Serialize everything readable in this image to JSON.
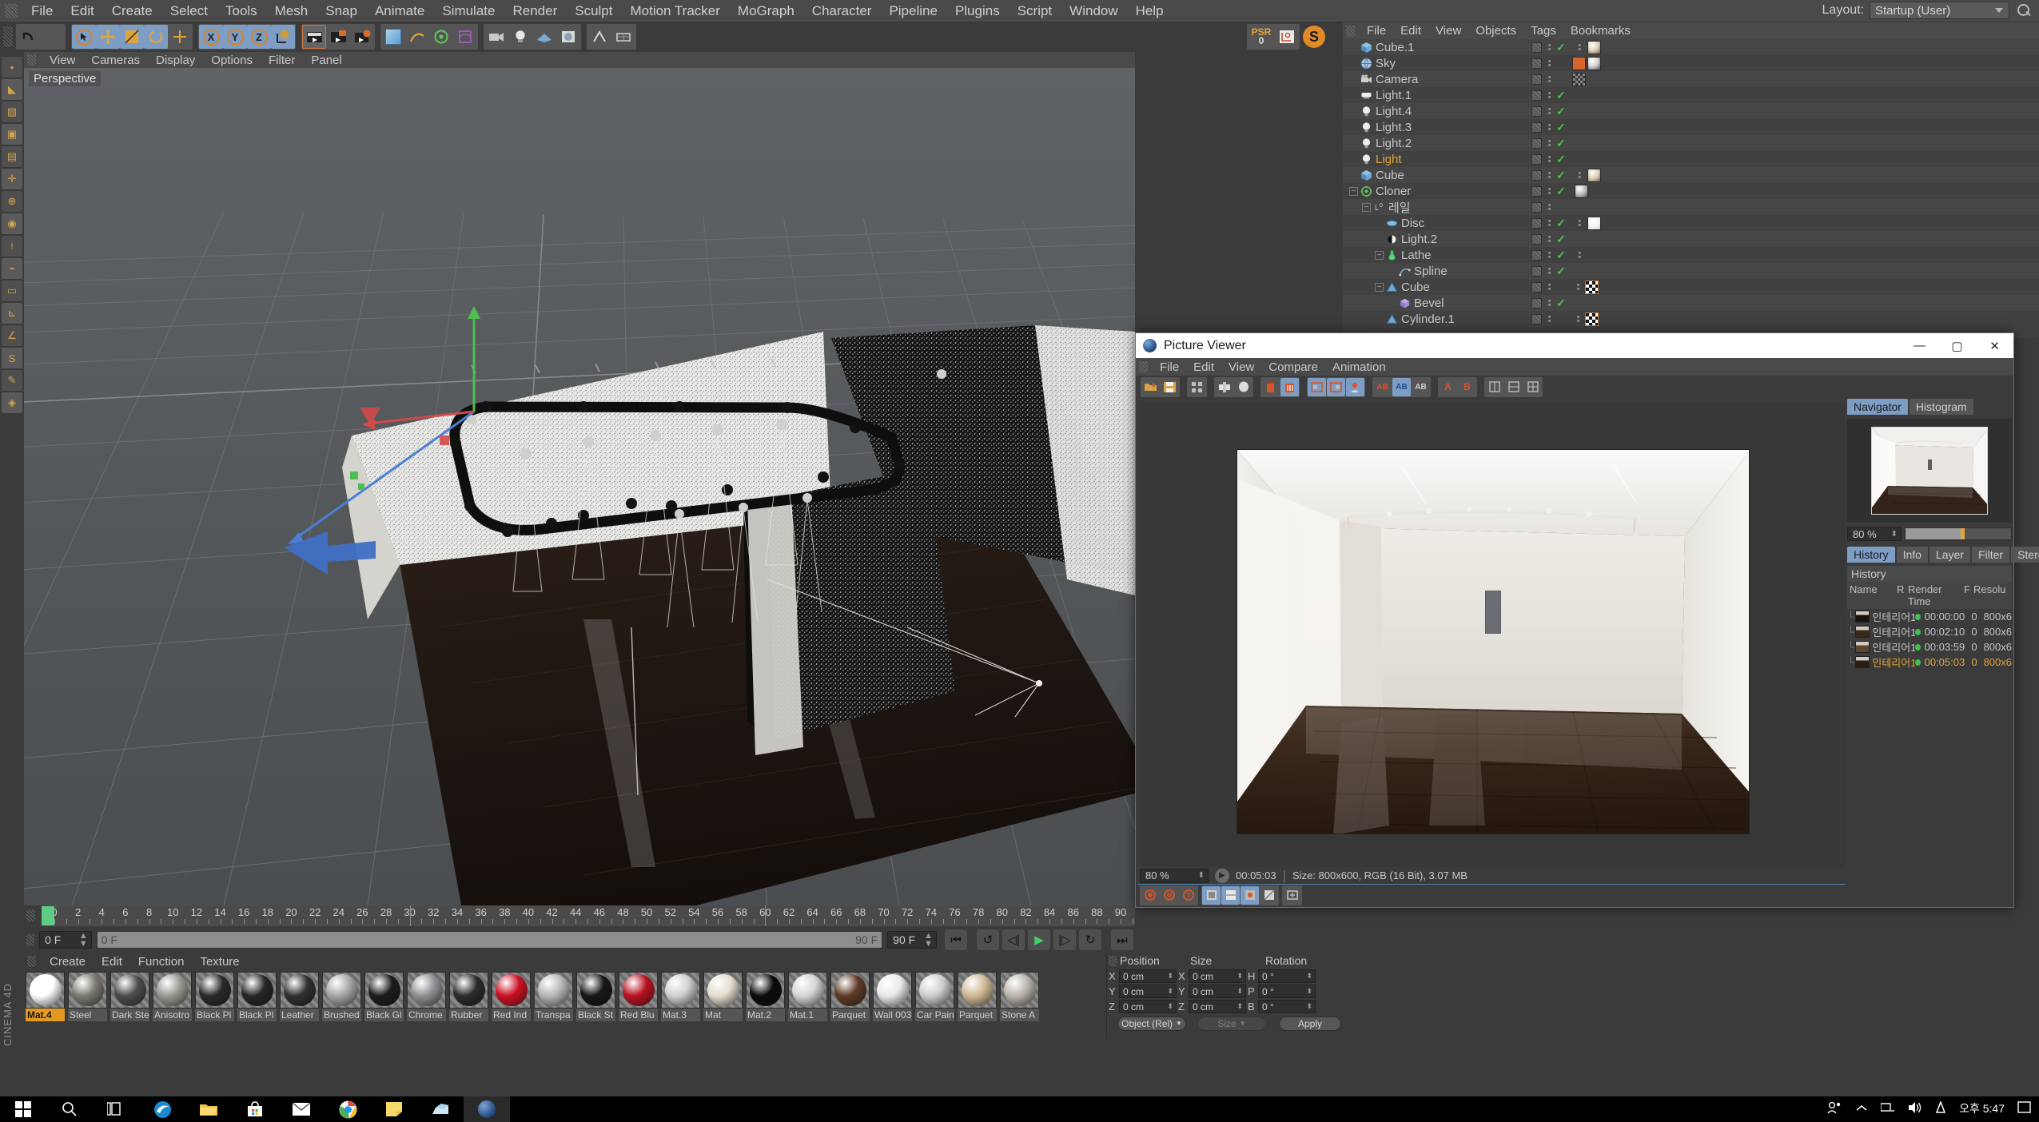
{
  "app": {
    "title": "CINEMA 4D",
    "sidebar_label": "CINEMA 4D"
  },
  "menubar": {
    "items": [
      "File",
      "Edit",
      "Create",
      "Select",
      "Tools",
      "Mesh",
      "Snap",
      "Animate",
      "Simulate",
      "Render",
      "Sculpt",
      "Motion Tracker",
      "MoGraph",
      "Character",
      "Pipeline",
      "Plugins",
      "Script",
      "Window",
      "Help"
    ],
    "layout_label": "Layout:",
    "layout_value": "Startup (User)"
  },
  "toolbar": {
    "psr_label": "PSR",
    "psr_value": "0",
    "buttons": [
      "undo",
      "redo",
      "select-live",
      "move",
      "scale",
      "rotate",
      "axis",
      "x-axis",
      "y-axis",
      "z-axis",
      "world-axis",
      "render-view",
      "render-region",
      "render-settings",
      "cube-primitive",
      "spline-pen",
      "array",
      "deformer",
      "camera",
      "light",
      "floor",
      "material",
      "texture-axis",
      "workplane"
    ]
  },
  "viewport": {
    "menus": [
      "View",
      "Cameras",
      "Display",
      "Options",
      "Filter",
      "Panel"
    ],
    "label": "Perspective"
  },
  "timeline": {
    "ticks": [
      0,
      2,
      4,
      6,
      8,
      10,
      12,
      14,
      16,
      18,
      20,
      22,
      24,
      26,
      28,
      30,
      32,
      34,
      36,
      38,
      40,
      42,
      44,
      46,
      48,
      50,
      52,
      54,
      56,
      58,
      60,
      62,
      64,
      66,
      68,
      70,
      72,
      74,
      76,
      78,
      80,
      82,
      84,
      86,
      88,
      90
    ],
    "current_frame": "0 F",
    "scrub_start": "0 F",
    "scrub_end": "90 F",
    "end_frame": "90 F",
    "transport": [
      "go-to-start",
      "play-backward",
      "step-back",
      "play-forward",
      "step-forward",
      "loop",
      "go-to-end"
    ]
  },
  "materials": {
    "menus": [
      "Create",
      "Edit",
      "Function",
      "Texture"
    ],
    "items": [
      {
        "name": "Mat.4",
        "color": "#ffffff",
        "selected": true
      },
      {
        "name": "Steel",
        "color": "#7d7a72",
        "selected": false
      },
      {
        "name": "Dark Ste",
        "color": "#4e4d4a",
        "selected": false
      },
      {
        "name": "Anisotro",
        "color": "#9b9892",
        "selected": false
      },
      {
        "name": "Black Pl",
        "color": "#2a2a2a",
        "selected": false
      },
      {
        "name": "Black Pl",
        "color": "#262626",
        "selected": false
      },
      {
        "name": "Leather",
        "color": "#303030",
        "selected": false
      },
      {
        "name": "Brushed",
        "color": "#a6a6a2",
        "selected": false
      },
      {
        "name": "Black Gl",
        "color": "#1c1c1c",
        "selected": false
      },
      {
        "name": "Chrome",
        "color": "#8f9094",
        "selected": false
      },
      {
        "name": "Rubber",
        "color": "#2b2b2b",
        "selected": false
      },
      {
        "name": "Red Ind",
        "color": "#cc1122",
        "selected": false
      },
      {
        "name": "Transpa",
        "color": "#b7b7b7",
        "selected": false
      },
      {
        "name": "Black St",
        "color": "#171717",
        "selected": false
      },
      {
        "name": "Red Blu",
        "color": "#b8121f",
        "selected": false
      },
      {
        "name": "Mat.3",
        "color": "#d0d0d0",
        "selected": false
      },
      {
        "name": "Mat",
        "color": "#e4ddd0",
        "selected": false
      },
      {
        "name": "Mat.2",
        "color": "#0a0a0a",
        "selected": false
      },
      {
        "name": "Mat.1",
        "color": "#d4d4d4",
        "selected": false
      },
      {
        "name": "Parquet",
        "color": "#5e3b26",
        "selected": false
      },
      {
        "name": "Wall 003",
        "color": "#e9e9e9",
        "selected": false
      },
      {
        "name": "Car Pain",
        "color": "#cacfcc",
        "selected": false
      },
      {
        "name": "Parquet",
        "color": "#cfb894",
        "selected": false
      },
      {
        "name": "Stone A",
        "color": "#b9b4ad",
        "selected": false
      }
    ]
  },
  "coordinates": {
    "headers": [
      "Position",
      "Size",
      "Rotation"
    ],
    "position": {
      "x": "0 cm",
      "y": "0 cm",
      "z": "0 cm"
    },
    "size": {
      "x": "0 cm",
      "y": "0 cm",
      "z": "0 cm"
    },
    "rotation": {
      "h": "0 °",
      "p": "0 °",
      "b": "0 °"
    },
    "labels": {
      "px": "X",
      "py": "Y",
      "pz": "Z",
      "sx": "X",
      "sy": "Y",
      "sz": "Z",
      "rh": "H",
      "rp": "P",
      "rb": "B"
    },
    "mode_value": "Object (Rel)",
    "size_value": "Size",
    "apply_label": "Apply"
  },
  "object_manager": {
    "menus": [
      "File",
      "Edit",
      "View",
      "Objects",
      "Tags",
      "Bookmarks"
    ],
    "rows": [
      {
        "name": "Cube.1",
        "indent": 0,
        "icon": "cube",
        "check": true,
        "expand": "",
        "tags": [
          "dots",
          "img-beige"
        ],
        "highlight": false
      },
      {
        "name": "Sky",
        "indent": 0,
        "icon": "sky",
        "check": false,
        "expand": "",
        "tags": [
          "film",
          "img-sky"
        ],
        "highlight": false
      },
      {
        "name": "Camera",
        "indent": 0,
        "icon": "camera",
        "check": false,
        "expand": "",
        "tags": [
          "target"
        ],
        "highlight": false
      },
      {
        "name": "Light.1",
        "indent": 0,
        "icon": "arealight",
        "check": true,
        "expand": "",
        "tags": [],
        "highlight": false
      },
      {
        "name": "Light.4",
        "indent": 0,
        "icon": "light",
        "check": true,
        "expand": "",
        "tags": [],
        "highlight": false
      },
      {
        "name": "Light.3",
        "indent": 0,
        "icon": "light",
        "check": true,
        "expand": "",
        "tags": [],
        "highlight": false
      },
      {
        "name": "Light.2",
        "indent": 0,
        "icon": "light",
        "check": true,
        "expand": "",
        "tags": [],
        "highlight": false
      },
      {
        "name": "Light",
        "indent": 0,
        "icon": "light",
        "check": true,
        "expand": "",
        "tags": [],
        "highlight": true
      },
      {
        "name": "Cube",
        "indent": 0,
        "icon": "cube",
        "check": true,
        "expand": "",
        "tags": [
          "dots",
          "img-beige"
        ],
        "highlight": false
      },
      {
        "name": "Cloner",
        "indent": 0,
        "icon": "cloner",
        "check": true,
        "expand": "-",
        "tags": [
          "img-grey"
        ],
        "highlight": false
      },
      {
        "name": "레일",
        "indent": 1,
        "icon": "null",
        "check": false,
        "expand": "-",
        "tags": [],
        "highlight": false
      },
      {
        "name": "Disc",
        "indent": 2,
        "icon": "disc",
        "check": true,
        "expand": "",
        "tags": [
          "dots",
          "img-white"
        ],
        "highlight": false
      },
      {
        "name": "Light.2",
        "indent": 2,
        "icon": "lightsm",
        "check": true,
        "expand": "",
        "tags": [],
        "highlight": false
      },
      {
        "name": "Lathe",
        "indent": 2,
        "icon": "lathe",
        "check": true,
        "expand": "-",
        "tags": [
          "dots"
        ],
        "highlight": false
      },
      {
        "name": "Spline",
        "indent": 3,
        "icon": "spline",
        "check": true,
        "expand": "",
        "tags": [],
        "highlight": false
      },
      {
        "name": "Cube",
        "indent": 2,
        "icon": "poly",
        "check": false,
        "expand": "-",
        "tags": [
          "dots",
          "img-checker"
        ],
        "highlight": false
      },
      {
        "name": "Bevel",
        "indent": 3,
        "icon": "bevel",
        "check": true,
        "expand": "",
        "tags": [],
        "highlight": false
      },
      {
        "name": "Cylinder.1",
        "indent": 2,
        "icon": "poly",
        "check": false,
        "expand": "",
        "tags": [
          "dots",
          "img-checker"
        ],
        "highlight": false
      }
    ]
  },
  "picture_viewer": {
    "title": "Picture Viewer",
    "window_buttons": [
      "minimize",
      "maximize",
      "close"
    ],
    "menus": [
      "File",
      "Edit",
      "View",
      "Compare",
      "Animation"
    ],
    "zoom_value": "80 %",
    "time_value": "00:05:03",
    "size_info": "Size: 800x600, RGB (16 Bit), 3.07 MB",
    "nav_tabs": [
      {
        "label": "Navigator",
        "active": true
      },
      {
        "label": "Histogram",
        "active": false
      }
    ],
    "nav_zoom": "80 %",
    "info_tabs": [
      {
        "label": "History",
        "active": true
      },
      {
        "label": "Info",
        "active": false
      },
      {
        "label": "Layer",
        "active": false
      },
      {
        "label": "Filter",
        "active": false
      },
      {
        "label": "Stereo",
        "active": false
      }
    ],
    "history_title": "History",
    "history_columns": [
      "Name",
      "R",
      "Render Time",
      "F",
      "Resolu"
    ],
    "history_rows": [
      {
        "name": "인테리어1 *",
        "render_time": "00:00:00",
        "f": "0",
        "res": "800x6",
        "selected": false
      },
      {
        "name": "인테리어1 *",
        "render_time": "00:02:10",
        "f": "0",
        "res": "800x6",
        "selected": false
      },
      {
        "name": "인테리어1 *",
        "render_time": "00:03:59",
        "f": "0",
        "res": "800x6",
        "selected": false
      },
      {
        "name": "인테리어1 *",
        "render_time": "00:05:03",
        "f": "0",
        "res": "800x6",
        "selected": true
      }
    ]
  },
  "taskbar": {
    "icons": [
      "start",
      "search",
      "task-view",
      "edge",
      "file-explorer",
      "store",
      "mail",
      "chrome",
      "sticky-notes",
      "onedrive",
      "cinema4d"
    ],
    "tray_icons": [
      "people",
      "show-hidden",
      "network",
      "volume",
      "ime"
    ],
    "clock": "오후 5:47"
  },
  "colors": {
    "accent_orange": "#e0a43c",
    "accent_blue": "#7d9dc4",
    "panel_bg": "#3b3b3b",
    "green_check": "#4fbf52"
  }
}
